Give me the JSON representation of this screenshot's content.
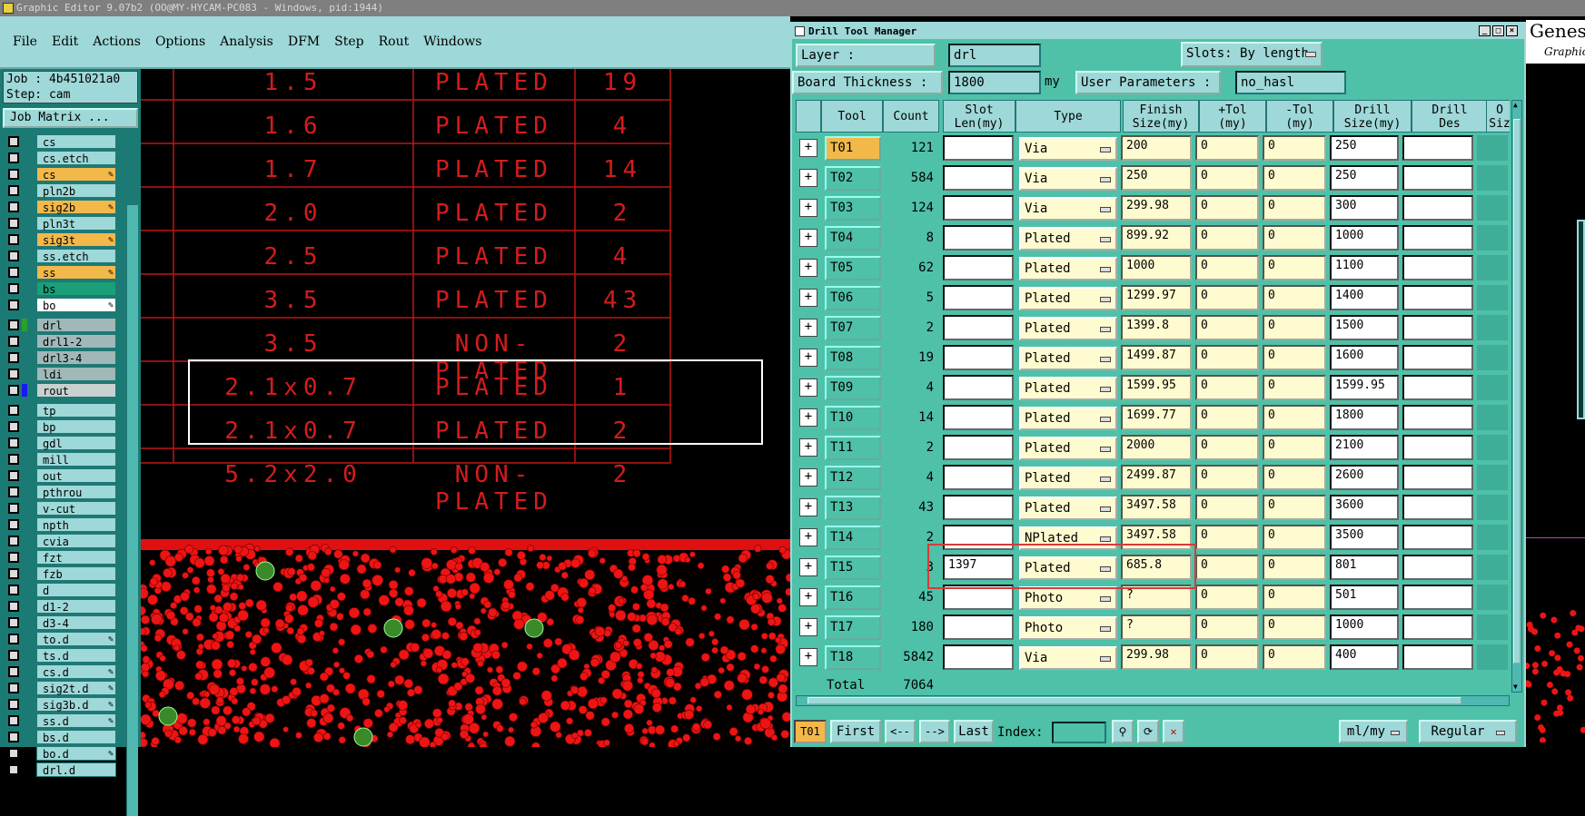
{
  "window_title": "Graphic Editor 9.07b2 (OO@MY-HYCAM-PC083 - Windows, pid:1944)",
  "menu": [
    "File",
    "Edit",
    "Actions",
    "Options",
    "Analysis",
    "DFM",
    "Step",
    "Rout",
    "Windows"
  ],
  "job": {
    "job_line": "Job : 4b451021a0",
    "step_line": "Step: cam",
    "matrix_button": "Job Matrix ..."
  },
  "layers": [
    {
      "name": "cs",
      "style": "nm",
      "marker": ""
    },
    {
      "name": "cs.etch",
      "style": "nm",
      "marker": ""
    },
    {
      "name": "cs",
      "style": "hl",
      "marker": "✎"
    },
    {
      "name": "pln2b",
      "style": "nm",
      "marker": ""
    },
    {
      "name": "sig2b",
      "style": "hl",
      "marker": "✎"
    },
    {
      "name": "pln3t",
      "style": "nm",
      "marker": ""
    },
    {
      "name": "sig3t",
      "style": "hl",
      "marker": "✎"
    },
    {
      "name": "ss.etch",
      "style": "nm",
      "marker": ""
    },
    {
      "name": "ss",
      "style": "hl",
      "marker": "✎"
    },
    {
      "name": "bs",
      "style": "gr",
      "marker": ""
    },
    {
      "name": "bo",
      "style": "wh",
      "marker": "✎"
    },
    {
      "name": "drl",
      "style": "gy",
      "marker": ""
    },
    {
      "name": "drl1-2",
      "style": "gy",
      "marker": ""
    },
    {
      "name": "drl3-4",
      "style": "gy",
      "marker": ""
    },
    {
      "name": "ldi",
      "style": "gy",
      "marker": ""
    },
    {
      "name": "rout",
      "style": "ltg",
      "marker": ""
    },
    {
      "name": "tp",
      "style": "nm",
      "marker": ""
    },
    {
      "name": "bp",
      "style": "nm",
      "marker": ""
    },
    {
      "name": "gdl",
      "style": "nm",
      "marker": ""
    },
    {
      "name": "mill",
      "style": "nm",
      "marker": ""
    },
    {
      "name": "out",
      "style": "nm",
      "marker": ""
    },
    {
      "name": "pthrou",
      "style": "nm",
      "marker": ""
    },
    {
      "name": "v-cut",
      "style": "nm",
      "marker": ""
    },
    {
      "name": "npth",
      "style": "nm",
      "marker": ""
    },
    {
      "name": "cvia",
      "style": "nm",
      "marker": ""
    },
    {
      "name": "fzt",
      "style": "nm",
      "marker": ""
    },
    {
      "name": "fzb",
      "style": "nm",
      "marker": ""
    },
    {
      "name": "d",
      "style": "nm",
      "marker": ""
    },
    {
      "name": "d1-2",
      "style": "nm",
      "marker": ""
    },
    {
      "name": "d3-4",
      "style": "nm",
      "marker": ""
    },
    {
      "name": "to.d",
      "style": "nm",
      "marker": "✎"
    },
    {
      "name": "ts.d",
      "style": "nm",
      "marker": ""
    },
    {
      "name": "cs.d",
      "style": "nm",
      "marker": "✎"
    },
    {
      "name": "sig2t.d",
      "style": "nm",
      "marker": "✎"
    },
    {
      "name": "sig3b.d",
      "style": "nm",
      "marker": "✎"
    },
    {
      "name": "ss.d",
      "style": "nm",
      "marker": "✎"
    },
    {
      "name": "bs.d",
      "style": "nm",
      "marker": ""
    },
    {
      "name": "bo.d",
      "style": "nm",
      "marker": "✎"
    },
    {
      "name": "drl.d",
      "style": "nm",
      "marker": ""
    }
  ],
  "drill_table": [
    {
      "size": "1.5",
      "type": "PLATED",
      "count": "19"
    },
    {
      "size": "1.6",
      "type": "PLATED",
      "count": "4"
    },
    {
      "size": "1.7",
      "type": "PLATED",
      "count": "14"
    },
    {
      "size": "2.0",
      "type": "PLATED",
      "count": "2"
    },
    {
      "size": "2.5",
      "type": "PLATED",
      "count": "4"
    },
    {
      "size": "3.5",
      "type": "PLATED",
      "count": "43"
    },
    {
      "size": "3.5",
      "type": "NON-PLATED",
      "count": "2"
    },
    {
      "size": "2.1x0.7",
      "type": "PLATED",
      "count": "1"
    },
    {
      "size": "2.1x0.7",
      "type": "PLATED",
      "count": "2"
    },
    {
      "size": "5.2x2.0",
      "type": "NON-PLATED",
      "count": "2"
    }
  ],
  "dtm": {
    "title": "Drill Tool Manager",
    "layer_label": "Layer        :",
    "layer_value": "drl",
    "slots_label": "Slots:",
    "slots_value": "By length",
    "thickness_label": "Board Thickness  :",
    "thickness_value": "1800",
    "thickness_unit": "my",
    "userparams_label": "User Parameters  :",
    "userparams_value": "no_hasl",
    "headers": [
      "Tool",
      "Count",
      "Slot\nLen(my)",
      "Type",
      "Finish\nSize(my)",
      "+Tol\n(my)",
      "-Tol\n(my)",
      "Drill\nSize(my)",
      "Drill\nDes",
      "O\nSiz"
    ],
    "rows": [
      {
        "tool": "T01",
        "count": "121",
        "slot": "",
        "type": "Via",
        "finish": "200",
        "ptol": "0",
        "mtol": "0",
        "dsize": "250",
        "ddes": ""
      },
      {
        "tool": "T02",
        "count": "584",
        "slot": "",
        "type": "Via",
        "finish": "250",
        "ptol": "0",
        "mtol": "0",
        "dsize": "250",
        "ddes": ""
      },
      {
        "tool": "T03",
        "count": "124",
        "slot": "",
        "type": "Via",
        "finish": "299.98",
        "ptol": "0",
        "mtol": "0",
        "dsize": "300",
        "ddes": ""
      },
      {
        "tool": "T04",
        "count": "8",
        "slot": "",
        "type": "Plated",
        "finish": "899.92",
        "ptol": "0",
        "mtol": "0",
        "dsize": "1000",
        "ddes": ""
      },
      {
        "tool": "T05",
        "count": "62",
        "slot": "",
        "type": "Plated",
        "finish": "1000",
        "ptol": "0",
        "mtol": "0",
        "dsize": "1100",
        "ddes": ""
      },
      {
        "tool": "T06",
        "count": "5",
        "slot": "",
        "type": "Plated",
        "finish": "1299.97",
        "ptol": "0",
        "mtol": "0",
        "dsize": "1400",
        "ddes": ""
      },
      {
        "tool": "T07",
        "count": "2",
        "slot": "",
        "type": "Plated",
        "finish": "1399.8",
        "ptol": "0",
        "mtol": "0",
        "dsize": "1500",
        "ddes": ""
      },
      {
        "tool": "T08",
        "count": "19",
        "slot": "",
        "type": "Plated",
        "finish": "1499.87",
        "ptol": "0",
        "mtol": "0",
        "dsize": "1600",
        "ddes": ""
      },
      {
        "tool": "T09",
        "count": "4",
        "slot": "",
        "type": "Plated",
        "finish": "1599.95",
        "ptol": "0",
        "mtol": "0",
        "dsize": "1599.95",
        "ddes": ""
      },
      {
        "tool": "T10",
        "count": "14",
        "slot": "",
        "type": "Plated",
        "finish": "1699.77",
        "ptol": "0",
        "mtol": "0",
        "dsize": "1800",
        "ddes": ""
      },
      {
        "tool": "T11",
        "count": "2",
        "slot": "",
        "type": "Plated",
        "finish": "2000",
        "ptol": "0",
        "mtol": "0",
        "dsize": "2100",
        "ddes": ""
      },
      {
        "tool": "T12",
        "count": "4",
        "slot": "",
        "type": "Plated",
        "finish": "2499.87",
        "ptol": "0",
        "mtol": "0",
        "dsize": "2600",
        "ddes": ""
      },
      {
        "tool": "T13",
        "count": "43",
        "slot": "",
        "type": "Plated",
        "finish": "3497.58",
        "ptol": "0",
        "mtol": "0",
        "dsize": "3600",
        "ddes": ""
      },
      {
        "tool": "T14",
        "count": "2",
        "slot": "",
        "type": "NPlated",
        "finish": "3497.58",
        "ptol": "0",
        "mtol": "0",
        "dsize": "3500",
        "ddes": ""
      },
      {
        "tool": "T15",
        "count": "3",
        "slot": "1397",
        "type": "Plated",
        "finish": "685.8",
        "ptol": "0",
        "mtol": "0",
        "dsize": "801",
        "ddes": ""
      },
      {
        "tool": "T16",
        "count": "45",
        "slot": "",
        "type": "Photo",
        "finish": "?",
        "ptol": "0",
        "mtol": "0",
        "dsize": "501",
        "ddes": ""
      },
      {
        "tool": "T17",
        "count": "180",
        "slot": "",
        "type": "Photo",
        "finish": "?",
        "ptol": "0",
        "mtol": "0",
        "dsize": "1000",
        "ddes": ""
      },
      {
        "tool": "T18",
        "count": "5842",
        "slot": "",
        "type": "Via",
        "finish": "299.98",
        "ptol": "0",
        "mtol": "0",
        "dsize": "400",
        "ddes": ""
      }
    ],
    "total_label": "Total",
    "total_value": "7064",
    "bottom": {
      "current": "T01",
      "first": "First",
      "prev": "<--",
      "next": "-->",
      "last": "Last",
      "index_label": "Index:",
      "units": "ml/my",
      "mode": "Regular"
    }
  },
  "genesis": {
    "title": "Genesis",
    "subtitle": "Graphic"
  },
  "colors": {
    "accent": "#9ed8d8",
    "highlight": "#f3b84a",
    "table_red": "#d51c1c",
    "panel": "#4fc1a8"
  }
}
